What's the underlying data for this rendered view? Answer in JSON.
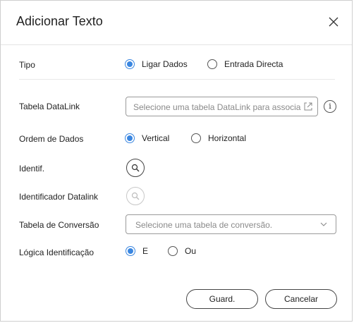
{
  "dialog": {
    "title": "Adicionar Texto",
    "close_icon": "close-icon"
  },
  "tipo": {
    "label": "Tipo",
    "options": [
      {
        "label": "Ligar Dados",
        "checked": true
      },
      {
        "label": "Entrada Directa",
        "checked": false
      }
    ]
  },
  "tabela_datalink": {
    "label": "Tabela DataLink",
    "placeholder": "Selecione uma tabela DataLink para associar...",
    "external_icon": "external-link-icon",
    "info_icon": "info-icon",
    "info_glyph": "i"
  },
  "ordem_dados": {
    "label": "Ordem de Dados",
    "options": [
      {
        "label": "Vertical",
        "checked": true
      },
      {
        "label": "Horizontal",
        "checked": false
      }
    ]
  },
  "identif": {
    "label": "Identif.",
    "icon": "search-icon"
  },
  "identificador_datalink": {
    "label": "Identificador Datalink",
    "icon": "search-icon",
    "disabled": true
  },
  "tabela_conversao": {
    "label": "Tabela de Conversão",
    "placeholder": "Selecione uma tabela de conversão.",
    "icon": "chevron-down-icon"
  },
  "logica": {
    "label": "Lógica Identificação",
    "options": [
      {
        "label": "E",
        "checked": true
      },
      {
        "label": "Ou",
        "checked": false
      }
    ]
  },
  "footer": {
    "save_label": "Guard.",
    "cancel_label": "Cancelar"
  },
  "colors": {
    "accent": "#3a86e0",
    "border": "#9a9a9a"
  }
}
